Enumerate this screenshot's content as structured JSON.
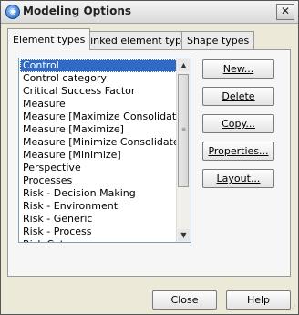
{
  "window": {
    "title": "Modeling Options",
    "close_glyph": "✕",
    "app_icon": "modeling-icon"
  },
  "tabs": [
    {
      "label": "Element types",
      "active": true
    },
    {
      "label": "Linked element types",
      "active": false
    },
    {
      "label": "Shape types",
      "active": false
    }
  ],
  "element_list": {
    "items": [
      "Control",
      "Control category",
      "Critical Success Factor",
      "Measure",
      "Measure [Maximize Consolidate]",
      "Measure [Maximize]",
      "Measure [Minimize Consolidate]",
      "Measure [Minimize]",
      "Perspective",
      "Processes",
      "Risk - Decision Making",
      "Risk - Environment",
      "Risk - Generic",
      "Risk - Process",
      "Risk Category"
    ],
    "selected_index": 0
  },
  "actions": {
    "new": "New...",
    "delete": "Delete",
    "copy": "Copy...",
    "properties": "Properties...",
    "layout": "Layout..."
  },
  "footer": {
    "close": "Close",
    "help": "Help"
  },
  "colors": {
    "selection": "#316ac5",
    "window_bg": "#ece9d8"
  }
}
